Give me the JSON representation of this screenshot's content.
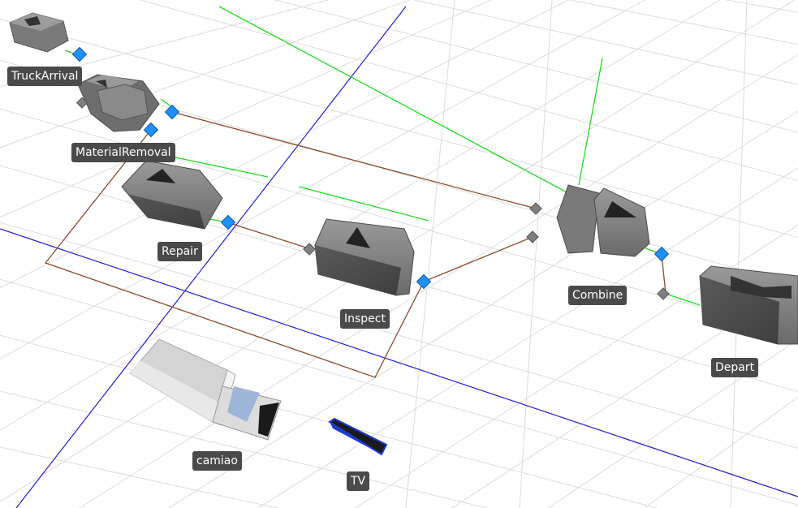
{
  "scene": {
    "objects": [
      {
        "key": "truck_arrival",
        "label": "TruckArrival"
      },
      {
        "key": "material_removal",
        "label": "MaterialRemoval"
      },
      {
        "key": "repair",
        "label": "Repair"
      },
      {
        "key": "inspect",
        "label": "Inspect"
      },
      {
        "key": "combine",
        "label": "Combine"
      },
      {
        "key": "depart",
        "label": "Depart"
      },
      {
        "key": "camiao",
        "label": "camiao"
      },
      {
        "key": "tv",
        "label": "TV"
      }
    ]
  },
  "colors": {
    "background": "#ffffff",
    "grid": "#d9d9d9",
    "axis": "#1f1fd0",
    "connector_out": "#8a4b2a",
    "connector_in": "#22dd22",
    "output_port": "#1e90ff",
    "input_port": "#808080",
    "object_body": "#6e6e6e",
    "label_bg": "#4a4a4a",
    "label_text": "#ffffff"
  }
}
